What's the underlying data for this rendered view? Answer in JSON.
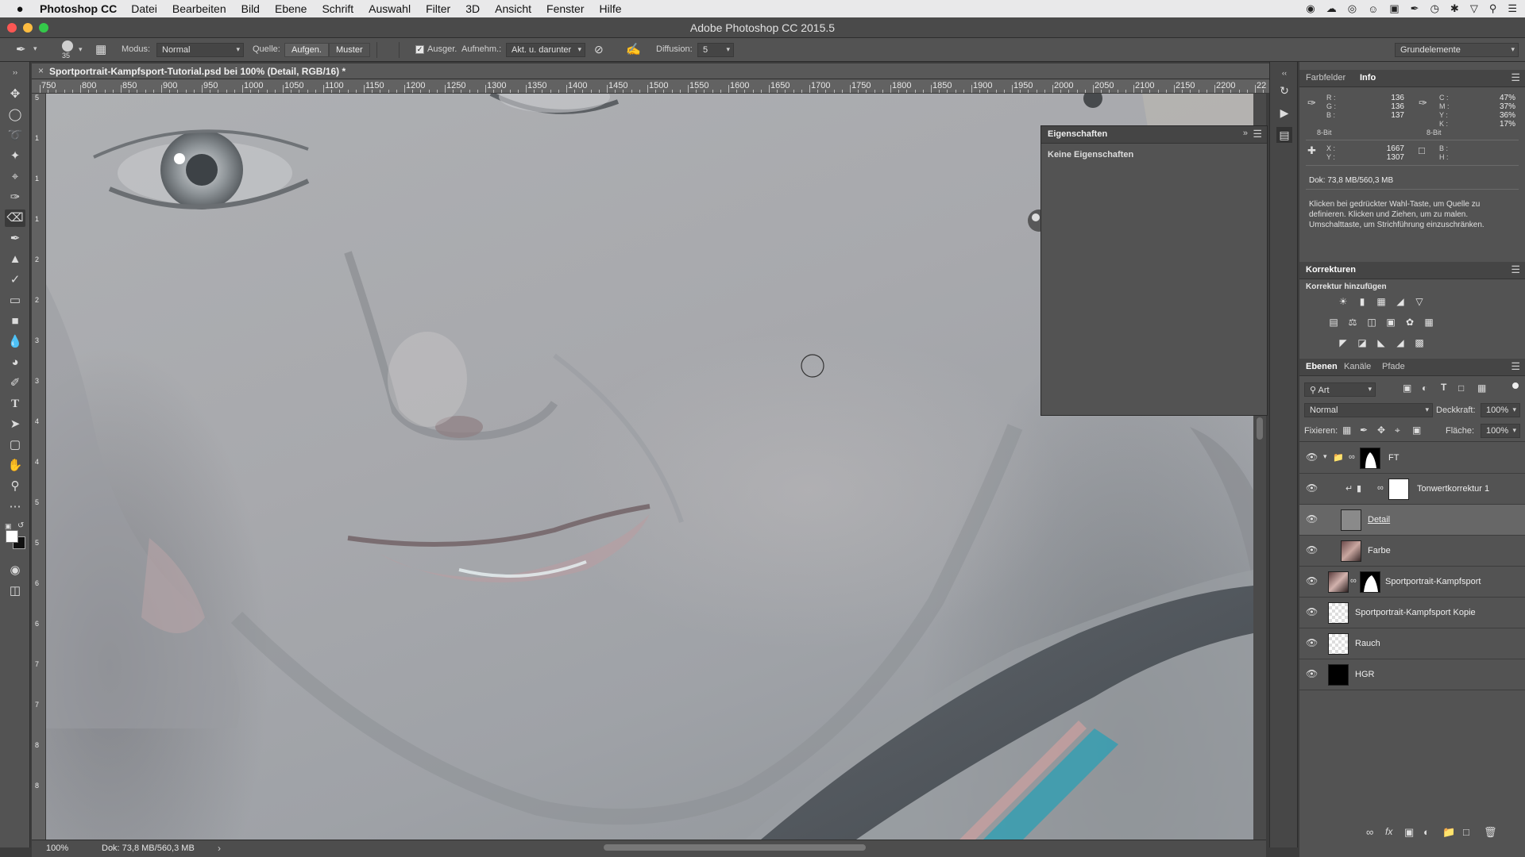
{
  "menubar": {
    "apple": "",
    "app_name": "Photoshop CC",
    "items": [
      "Datei",
      "Bearbeiten",
      "Bild",
      "Ebene",
      "Schrift",
      "Auswahl",
      "Filter",
      "3D",
      "Ansicht",
      "Fenster",
      "Hilfe"
    ]
  },
  "window": {
    "title": "Adobe Photoshop CC 2015.5"
  },
  "options": {
    "brush_size": "35",
    "mode_label": "Modus:",
    "mode_value": "Normal",
    "source_label": "Quelle:",
    "sampled_btn": "Aufgen.",
    "pattern_btn": "Muster",
    "aligned_label": "Ausger.",
    "sample_label": "Aufnehm.:",
    "sample_value": "Akt. u. darunter",
    "diffusion_label": "Diffusion:",
    "diffusion_value": "5",
    "workspace": "Grundelemente"
  },
  "document": {
    "tab_title": "Sportportrait-Kampfsport-Tutorial.psd bei 100% (Detail, RGB/16) *",
    "ruler_h": [
      "750",
      "800",
      "850",
      "900",
      "950",
      "1000",
      "1050",
      "1100",
      "1150",
      "1200",
      "1250",
      "1300",
      "1350",
      "1400",
      "1450",
      "1500",
      "1550",
      "1600",
      "1650",
      "1700",
      "1750",
      "1800",
      "1850",
      "1900",
      "1950",
      "2000",
      "2050",
      "2100",
      "2150",
      "2200",
      "22"
    ],
    "ruler_v": [
      "5",
      "1",
      "1",
      "1",
      "2",
      "2",
      "3",
      "3",
      "4",
      "4",
      "5",
      "5",
      "6",
      "6",
      "7",
      "7",
      "8",
      "8"
    ],
    "zoom": "100%",
    "doc_size": "Dok: 73,8 MB/560,3 MB"
  },
  "properties": {
    "title": "Eigenschaften",
    "empty": "Keine Eigenschaften"
  },
  "info": {
    "tab_swatches": "Farbfelder",
    "tab_info": "Info",
    "rgb": {
      "r": "136",
      "g": "136",
      "b": "137",
      "r_label": "R :",
      "g_label": "G :",
      "b_label": "B :"
    },
    "cmyk": {
      "c": "47%",
      "m": "37%",
      "y": "36%",
      "k": "17%",
      "c_label": "C :",
      "m_label": "M :",
      "y_label": "Y :",
      "k_label": "K :"
    },
    "bit_left": "8-Bit",
    "bit_right": "8-Bit",
    "xy": {
      "x": "1667",
      "y": "1307",
      "x_label": "X :",
      "y_label": "Y :"
    },
    "wh": {
      "w_label": "B :",
      "h_label": "H :"
    },
    "doc": "Dok: 73,8 MB/560,3 MB",
    "hint": "Klicken bei gedrückter Wahl-Taste, um Quelle zu definieren. Klicken und Ziehen, um zu malen. Umschalttaste, um Strichführung einzuschränken."
  },
  "adjustments": {
    "title": "Korrekturen",
    "subtitle": "Korrektur hinzufügen"
  },
  "layers": {
    "tabs": [
      "Ebenen",
      "Kanäle",
      "Pfade"
    ],
    "filter": "Art",
    "blend": "Normal",
    "opacity_label": "Deckkraft:",
    "opacity": "100%",
    "lock_label": "Fixieren:",
    "fill_label": "Fläche:",
    "fill": "100%",
    "items": [
      {
        "name": "FT",
        "kind": "group"
      },
      {
        "name": "Tonwertkorrektur 1",
        "kind": "adjustment"
      },
      {
        "name": "Detail",
        "kind": "layer",
        "selected": true
      },
      {
        "name": "Farbe",
        "kind": "layer"
      },
      {
        "name": "Sportportrait-Kampfsport",
        "kind": "masked"
      },
      {
        "name": "Sportportrait-Kampfsport Kopie",
        "kind": "layer"
      },
      {
        "name": "Rauch",
        "kind": "layer"
      },
      {
        "name": "HGR",
        "kind": "layer"
      }
    ]
  },
  "colors": {
    "menubar": "#e9e9ea",
    "panel": "#535353",
    "selected_row": "#676767",
    "close": "#fc5753",
    "minimize": "#fdbc40",
    "zoom": "#34c84a"
  }
}
